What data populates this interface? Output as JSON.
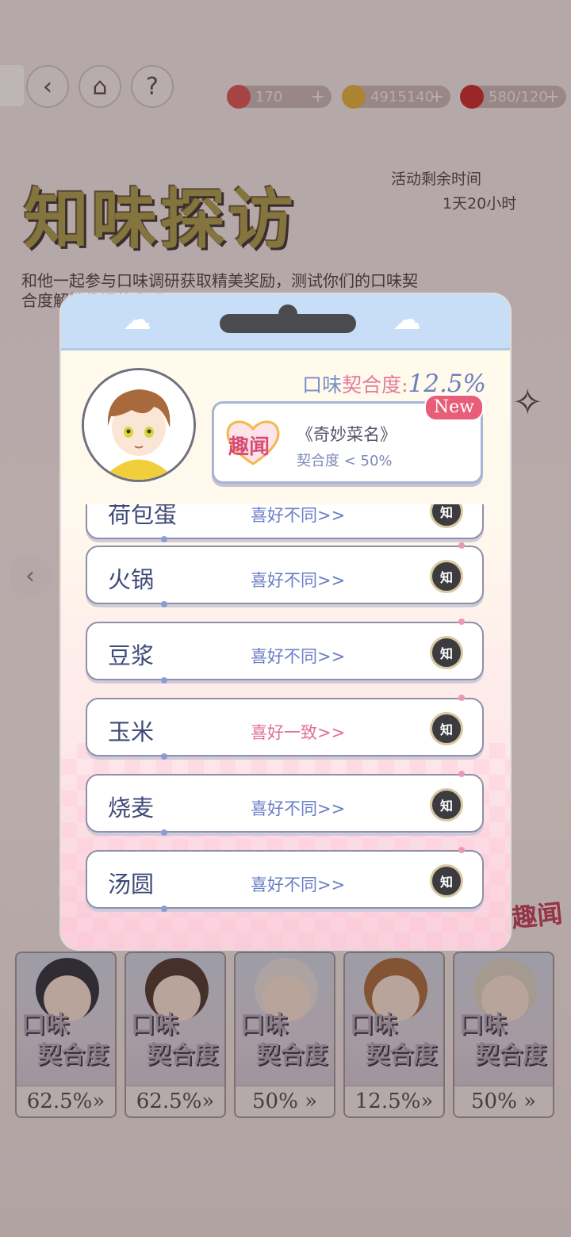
{
  "resources": [
    {
      "icon": "ticket-icon",
      "value": "170",
      "color": "#d9534f"
    },
    {
      "icon": "coin-icon",
      "value": "4915140",
      "color": "#e0b03a"
    },
    {
      "icon": "apple-icon",
      "value": "580/120",
      "color": "#c62828"
    }
  ],
  "header": {
    "back_symbol": "‹",
    "home_symbol": "⌂",
    "help_symbol": "?"
  },
  "event": {
    "title": "知味探访",
    "timer_label": "活动剩余时间",
    "timer_value": "1天20小时",
    "description": "和他一起参与口味调研获取精美奖励，测试你们的口味契合度解锁趣闻故事吧"
  },
  "bottom_cards": [
    {
      "tag1": "口味",
      "tag2": "契合度",
      "percent": "62.5%»",
      "hair": "#2b2f3a"
    },
    {
      "tag1": "口味",
      "tag2": "契合度",
      "percent": "62.5%»",
      "hair": "#4a372c"
    },
    {
      "tag1": "口味",
      "tag2": "契合度",
      "percent": "50% »",
      "hair": "#e4e0dc"
    },
    {
      "tag1": "口味",
      "tag2": "契合度",
      "percent": "12.5%»",
      "hair": "#a66a3a"
    },
    {
      "tag1": "口味",
      "tag2": "契合度",
      "percent": "50% »",
      "hair": "#d9d2c3"
    }
  ],
  "bg_fun_badge": "趣闻",
  "modal": {
    "match_prefix": "口味",
    "match_highlight": "契合度:",
    "match_value": "12.5%",
    "fun_heart_label": "趣闻",
    "fun_title": "《奇妙菜名》",
    "fun_condition": "契合度 < 50%",
    "new_badge": "New",
    "btn_label": "知",
    "list": [
      {
        "name": "荷包蛋",
        "status": "喜好不同>>",
        "match": false
      },
      {
        "name": "火锅",
        "status": "喜好不同>>",
        "match": false
      },
      {
        "name": "豆浆",
        "status": "喜好不同>>",
        "match": false
      },
      {
        "name": "玉米",
        "status": "喜好一致>>",
        "match": true
      },
      {
        "name": "烧麦",
        "status": "喜好不同>>",
        "match": false
      },
      {
        "name": "汤圆",
        "status": "喜好不同>>",
        "match": false
      }
    ]
  },
  "colors": {
    "accent_pink": "#e27b9b",
    "accent_blue": "#7b8fc7",
    "modal_header": "#c8def7"
  }
}
